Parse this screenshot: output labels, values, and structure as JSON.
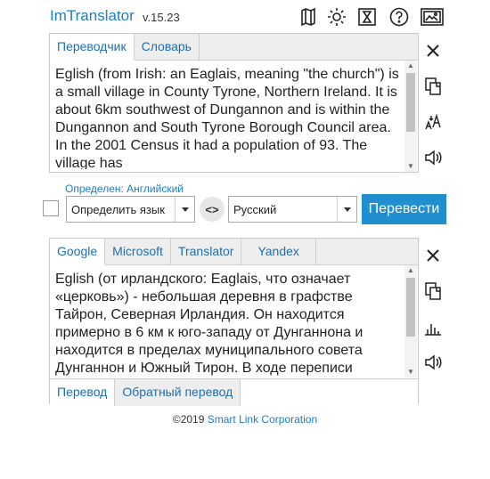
{
  "header": {
    "title": "ImTranslator",
    "version": "v.15.23",
    "icons": [
      "map-icon",
      "settings-gear-icon",
      "hourglass-history-icon",
      "help-icon",
      "image-translate-icon"
    ]
  },
  "source": {
    "tabs": [
      {
        "label": "Переводчик",
        "active": true
      },
      {
        "label": "Словарь",
        "active": false
      }
    ],
    "text": "Eglish (from Irish: an Eaglais, meaning \"the church\") is a small village in County Tyrone, Northern Ireland. It is about 6km southwest of Dungannon and is within the Dungannon and South Tyrone Borough Council area. In the 2001 Census it had a population of 93. The village has",
    "side_icons": [
      "clear-icon",
      "copy-icon",
      "font-size-icon",
      "speaker-icon"
    ]
  },
  "controls": {
    "detected": "Определен: Английский",
    "source_lang": "Определить язык",
    "swap_symbol": "<>",
    "target_lang": "Русский",
    "translate_label": "Перевести"
  },
  "result": {
    "tabs": [
      {
        "label": "Google",
        "active": true
      },
      {
        "label": "Microsoft",
        "active": false
      },
      {
        "label": "Translator",
        "active": false
      },
      {
        "label": "Yandex",
        "active": false
      }
    ],
    "text": "Eglish (от ирландского: Eaglais, что означает «церковь») - небольшая деревня в графстве Тайрон, Северная Ирландия. Он находится примерно в 6 км к юго-западу от Дунганнона и находится в пределах муниципального совета Дунганнон и Южный Тирон. В ходе переписи",
    "bottom_tabs": [
      {
        "label": "Перевод",
        "active": true
      },
      {
        "label": "Обратный перевод",
        "active": false
      }
    ],
    "side_icons": [
      "clear-icon",
      "copy-icon",
      "chart-icon",
      "speaker-icon"
    ]
  },
  "footer": {
    "copyright": "©2019",
    "company": "Smart Link Corporation"
  },
  "colors": {
    "accent": "#1e7fbf",
    "button": "#1f8fd0"
  }
}
